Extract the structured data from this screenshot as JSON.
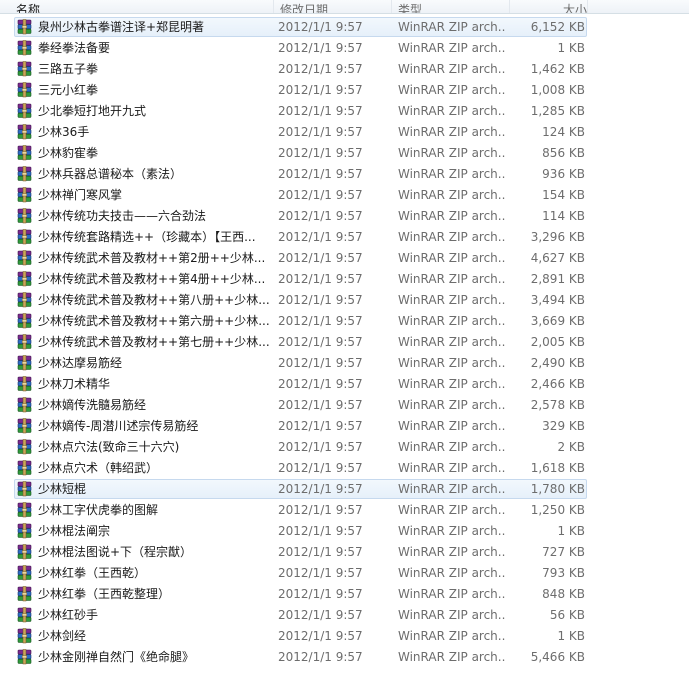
{
  "columns": {
    "name": "名称",
    "date": "修改日期",
    "type": "类型",
    "size": "大小"
  },
  "files": [
    {
      "name": "泉州少林古拳谱注译+郑昆明著",
      "date": "2012/1/1 9:57",
      "type": "WinRAR ZIP arch...",
      "size": "6,152 KB",
      "selected": true
    },
    {
      "name": "拳经拳法备要",
      "date": "2012/1/1 9:57",
      "type": "WinRAR ZIP arch...",
      "size": "1 KB"
    },
    {
      "name": "三路五子拳",
      "date": "2012/1/1 9:57",
      "type": "WinRAR ZIP arch...",
      "size": "1,462 KB"
    },
    {
      "name": "三元小红拳",
      "date": "2012/1/1 9:57",
      "type": "WinRAR ZIP arch...",
      "size": "1,008 KB"
    },
    {
      "name": "少北拳短打地开九式",
      "date": "2012/1/1 9:57",
      "type": "WinRAR ZIP arch...",
      "size": "1,285 KB"
    },
    {
      "name": "少林36手",
      "date": "2012/1/1 9:57",
      "type": "WinRAR ZIP arch...",
      "size": "124 KB"
    },
    {
      "name": "少林豹寉拳",
      "date": "2012/1/1 9:57",
      "type": "WinRAR ZIP arch...",
      "size": "856 KB"
    },
    {
      "name": "少林兵器总谱秘本（素法）",
      "date": "2012/1/1 9:57",
      "type": "WinRAR ZIP arch...",
      "size": "936 KB"
    },
    {
      "name": "少林禅门寒风掌",
      "date": "2012/1/1 9:57",
      "type": "WinRAR ZIP arch...",
      "size": "154 KB"
    },
    {
      "name": "少林传统功夫技击——六合劲法",
      "date": "2012/1/1 9:57",
      "type": "WinRAR ZIP arch...",
      "size": "114 KB"
    },
    {
      "name": "少林传统套路精选++（珍藏本）【王西...",
      "date": "2012/1/1 9:57",
      "type": "WinRAR ZIP arch...",
      "size": "3,296 KB"
    },
    {
      "name": "少林传统武术普及教材++第2册++少林...",
      "date": "2012/1/1 9:57",
      "type": "WinRAR ZIP arch...",
      "size": "4,627 KB"
    },
    {
      "name": "少林传统武术普及教材++第4册++少林...",
      "date": "2012/1/1 9:57",
      "type": "WinRAR ZIP arch...",
      "size": "2,891 KB"
    },
    {
      "name": "少林传统武术普及教材++第八册++少林...",
      "date": "2012/1/1 9:57",
      "type": "WinRAR ZIP arch...",
      "size": "3,494 KB"
    },
    {
      "name": "少林传统武术普及教材++第六册++少林...",
      "date": "2012/1/1 9:57",
      "type": "WinRAR ZIP arch...",
      "size": "3,669 KB"
    },
    {
      "name": "少林传统武术普及教材++第七册++少林...",
      "date": "2012/1/1 9:57",
      "type": "WinRAR ZIP arch...",
      "size": "2,005 KB"
    },
    {
      "name": "少林达摩易筋经",
      "date": "2012/1/1 9:57",
      "type": "WinRAR ZIP arch...",
      "size": "2,490 KB"
    },
    {
      "name": "少林刀术精华",
      "date": "2012/1/1 9:57",
      "type": "WinRAR ZIP arch...",
      "size": "2,466 KB"
    },
    {
      "name": "少林嫡传洗髓易筋经",
      "date": "2012/1/1 9:57",
      "type": "WinRAR ZIP arch...",
      "size": "2,578 KB"
    },
    {
      "name": "少林嫡传-周潜川述宗传易筋经",
      "date": "2012/1/1 9:57",
      "type": "WinRAR ZIP arch...",
      "size": "329 KB"
    },
    {
      "name": "少林点穴法(致命三十六穴)",
      "date": "2012/1/1 9:57",
      "type": "WinRAR ZIP arch...",
      "size": "2 KB"
    },
    {
      "name": "少林点穴术（韩绍武）",
      "date": "2012/1/1 9:57",
      "type": "WinRAR ZIP arch...",
      "size": "1,618 KB"
    },
    {
      "name": "少林短棍",
      "date": "2012/1/1 9:57",
      "type": "WinRAR ZIP arch...",
      "size": "1,780 KB",
      "selected": true
    },
    {
      "name": "少林工字伏虎拳的图解",
      "date": "2012/1/1 9:57",
      "type": "WinRAR ZIP arch...",
      "size": "1,250 KB"
    },
    {
      "name": "少林棍法阐宗",
      "date": "2012/1/1 9:57",
      "type": "WinRAR ZIP arch...",
      "size": "1 KB"
    },
    {
      "name": "少林棍法图说+下（程宗猷）",
      "date": "2012/1/1 9:57",
      "type": "WinRAR ZIP arch...",
      "size": "727 KB"
    },
    {
      "name": "少林红拳（王西乾）",
      "date": "2012/1/1 9:57",
      "type": "WinRAR ZIP arch...",
      "size": "793 KB"
    },
    {
      "name": "少林红拳（王西乾整理）",
      "date": "2012/1/1 9:57",
      "type": "WinRAR ZIP arch...",
      "size": "848 KB"
    },
    {
      "name": "少林红砂手",
      "date": "2012/1/1 9:57",
      "type": "WinRAR ZIP arch...",
      "size": "56 KB"
    },
    {
      "name": "少林剑经",
      "date": "2012/1/1 9:57",
      "type": "WinRAR ZIP arch...",
      "size": "1 KB"
    },
    {
      "name": "少林金刚禅自然门《绝命腿》",
      "date": "2012/1/1 9:57",
      "type": "WinRAR ZIP arch...",
      "size": "5,466 KB"
    }
  ],
  "icon": "winrar-archive-icon"
}
